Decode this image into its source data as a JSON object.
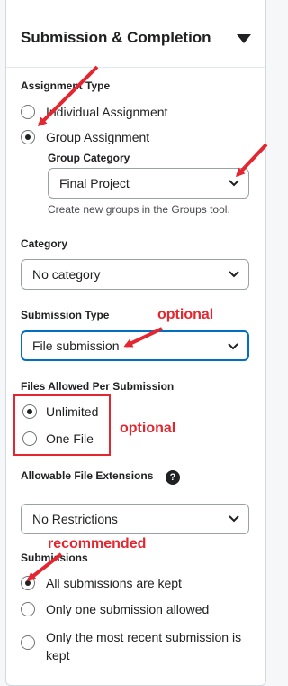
{
  "section": {
    "title": "Submission & Completion",
    "collapse_icon": "triangle-down-icon"
  },
  "assignment_type": {
    "label": "Assignment Type",
    "options": [
      {
        "label": "Individual Assignment",
        "selected": false
      },
      {
        "label": "Group Assignment",
        "selected": true
      }
    ],
    "group_category": {
      "label": "Group Category",
      "value": "Final Project",
      "help": "Create new groups in the Groups tool."
    }
  },
  "category": {
    "label": "Category",
    "value": "No category"
  },
  "submission_type": {
    "label": "Submission Type",
    "value": "File submission",
    "note": "optional"
  },
  "files_allowed": {
    "label": "Files Allowed Per Submission",
    "options": [
      {
        "label": "Unlimited",
        "selected": true
      },
      {
        "label": "One File",
        "selected": false
      }
    ],
    "note": "optional"
  },
  "file_extensions": {
    "label": "Allowable File Extensions",
    "help_icon": "question-circle-icon",
    "help_glyph": "?",
    "value": "No Restrictions"
  },
  "submissions": {
    "label": "Submissions",
    "note": "recommended",
    "options": [
      {
        "label": "All submissions are kept",
        "selected": true
      },
      {
        "label": "Only one submission allowed",
        "selected": false
      },
      {
        "label": "Only the most recent submission is kept",
        "selected": false
      }
    ]
  },
  "colors": {
    "annotation": "#e3262f",
    "focus": "#006fbf"
  }
}
